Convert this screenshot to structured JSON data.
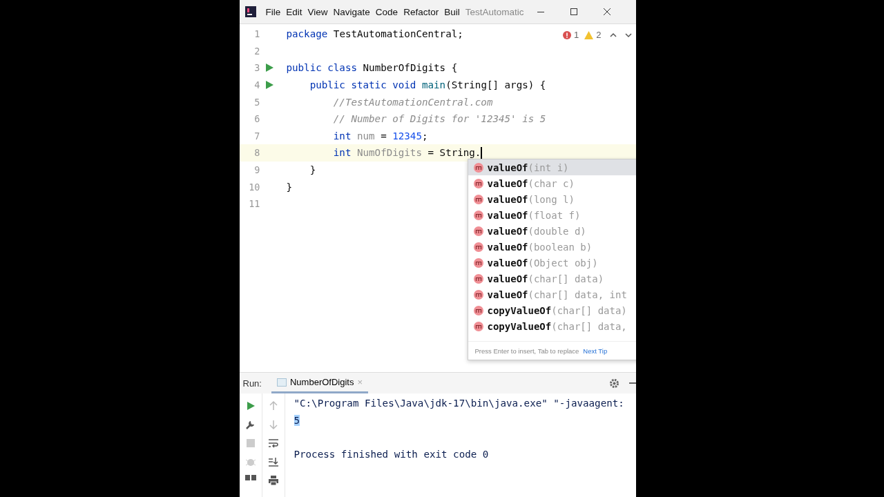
{
  "title_bar": {
    "menu": [
      {
        "label": "File"
      },
      {
        "label": "Edit"
      },
      {
        "label": "View"
      },
      {
        "label": "Navigate"
      },
      {
        "label": "Code"
      },
      {
        "label": "Refactor"
      },
      {
        "label": "Buil"
      }
    ],
    "project_title": "TestAutomatic"
  },
  "inspections": {
    "errors": "1",
    "warnings": "2"
  },
  "editor": {
    "lines": [
      {
        "number": "1",
        "run": false,
        "current": false,
        "tokens": [
          {
            "kind": "keyword",
            "text": "package "
          },
          {
            "kind": "plain",
            "text": "TestAutomationCentral;"
          }
        ]
      },
      {
        "number": "2",
        "run": false,
        "current": false
      },
      {
        "number": "3",
        "run": true,
        "current": false,
        "tokens": [
          {
            "kind": "keyword",
            "text": "public class "
          },
          {
            "kind": "plain",
            "text": "NumberOfDigits {"
          }
        ]
      },
      {
        "number": "4",
        "run": true,
        "current": false,
        "tokens": [
          {
            "kind": "keyword",
            "text": "    public static void "
          },
          {
            "kind": "method",
            "text": "main"
          },
          {
            "kind": "plain",
            "text": "(String[] args) {"
          }
        ]
      },
      {
        "number": "5",
        "run": false,
        "current": false,
        "tokens": [
          {
            "kind": "comment",
            "text": "        //TestAutomationCentral.com"
          }
        ]
      },
      {
        "number": "6",
        "run": false,
        "current": false,
        "tokens": [
          {
            "kind": "comment",
            "text": "        // Number of Digits for '12345' is 5"
          }
        ]
      },
      {
        "number": "7",
        "run": false,
        "current": false,
        "tokens": [
          {
            "kind": "keyword",
            "text": "        int "
          },
          {
            "kind": "unused",
            "text": "num"
          },
          {
            "kind": "plain",
            "text": " = "
          },
          {
            "kind": "number",
            "text": "12345"
          },
          {
            "kind": "plain",
            "text": ";"
          }
        ]
      },
      {
        "number": "8",
        "run": false,
        "current": true,
        "tokens": [
          {
            "kind": "keyword",
            "text": "        int "
          },
          {
            "kind": "unused",
            "text": "NumOfDigits"
          },
          {
            "kind": "plain",
            "text": " = String."
          }
        ]
      },
      {
        "number": "9",
        "run": false,
        "current": false,
        "tokens": [
          {
            "kind": "plain",
            "text": "    }"
          }
        ]
      },
      {
        "number": "10",
        "run": false,
        "current": false,
        "tokens": [
          {
            "kind": "plain",
            "text": "}"
          }
        ]
      },
      {
        "number": "11",
        "run": false,
        "current": false
      }
    ]
  },
  "completion": {
    "items": [
      {
        "name": "valueOf",
        "params": "(int i)",
        "selected": true
      },
      {
        "name": "valueOf",
        "params": "(char c)",
        "selected": false
      },
      {
        "name": "valueOf",
        "params": "(long l)",
        "selected": false
      },
      {
        "name": "valueOf",
        "params": "(float f)",
        "selected": false
      },
      {
        "name": "valueOf",
        "params": "(double d)",
        "selected": false
      },
      {
        "name": "valueOf",
        "params": "(boolean b)",
        "selected": false
      },
      {
        "name": "valueOf",
        "params": "(Object obj)",
        "selected": false
      },
      {
        "name": "valueOf",
        "params": "(char[] data)",
        "selected": false
      },
      {
        "name": "valueOf",
        "params": "(char[] data, int",
        "selected": false
      },
      {
        "name": "copyValueOf",
        "params": "(char[] data)",
        "selected": false
      },
      {
        "name": "copyValueOf",
        "params": "(char[] data,",
        "selected": false
      }
    ],
    "hint": "Press Enter to insert, Tab to replace",
    "next_tip": "Next Tip"
  },
  "run_panel": {
    "label": "Run:",
    "tab": {
      "label": "NumberOfDigits",
      "close": "×",
      "selected": true
    },
    "console": [
      {
        "text": "\"C:\\Program Files\\Java\\jdk-17\\bin\\java.exe\" \"-javaagent:",
        "selected": false
      },
      {
        "text": "5",
        "selected": true
      }
    ],
    "exit_message": "Process finished with exit code 0"
  }
}
